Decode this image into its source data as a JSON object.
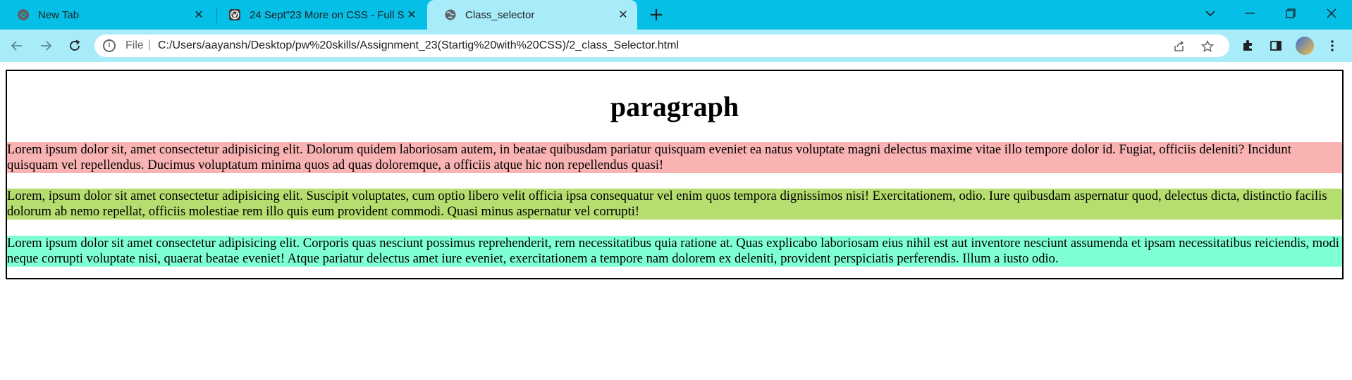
{
  "browser": {
    "tabs": [
      {
        "title": "New Tab",
        "icon": "chrome-icon",
        "active": false
      },
      {
        "title": "24 Sept\"23 More on CSS - Full S",
        "icon": "wordpress-icon",
        "active": false
      },
      {
        "title": "Class_selector",
        "icon": "globe-icon",
        "active": true
      }
    ],
    "address": {
      "scheme": "File",
      "url": "C:/Users/aayansh/Desktop/pw%20skills/Assignment_23(Startig%20with%20CSS)/2_class_Selector.html"
    },
    "accent_color": "#05bfe6",
    "toolbar_color": "#a8ecfa"
  },
  "page": {
    "heading": "paragraph",
    "paragraphs": [
      {
        "text": "Lorem ipsum dolor sit, amet consectetur adipisicing elit. Dolorum quidem laboriosam autem, in beatae quibusdam pariatur quisquam eveniet ea natus voluptate magni delectus maxime vitae illo tempore dolor id. Fugiat, officiis deleniti? Incidunt quisquam vel repellendus. Ducimus voluptatum minima quos ad quas doloremque, a officiis atque hic non repellendus quasi!",
        "background": "#f9b3b3"
      },
      {
        "text": "Lorem, ipsum dolor sit amet consectetur adipisicing elit. Suscipit voluptates, cum optio libero velit officia ipsa consequatur vel enim quos tempora dignissimos nisi! Exercitationem, odio. Iure quibusdam aspernatur quod, delectus dicta, distinctio facilis dolorum ab nemo repellat, officiis molestiae rem illo quis eum provident commodi. Quasi minus aspernatur vel corrupti!",
        "background": "#b5dd6f"
      },
      {
        "text": "Lorem ipsum dolor sit amet consectetur adipisicing elit. Corporis quas nesciunt possimus reprehenderit, rem necessitatibus quia ratione at. Quas explicabo laboriosam eius nihil est aut inventore nesciunt assumenda et ipsam necessitatibus reiciendis, modi neque corrupti voluptate nisi, quaerat beatae eveniet! Atque pariatur delectus amet iure eveniet, exercitationem a tempore nam dolorem ex deleniti, provident perspiciatis perferendis. Illum a iusto odio.",
        "background": "#7fffd4"
      }
    ]
  }
}
